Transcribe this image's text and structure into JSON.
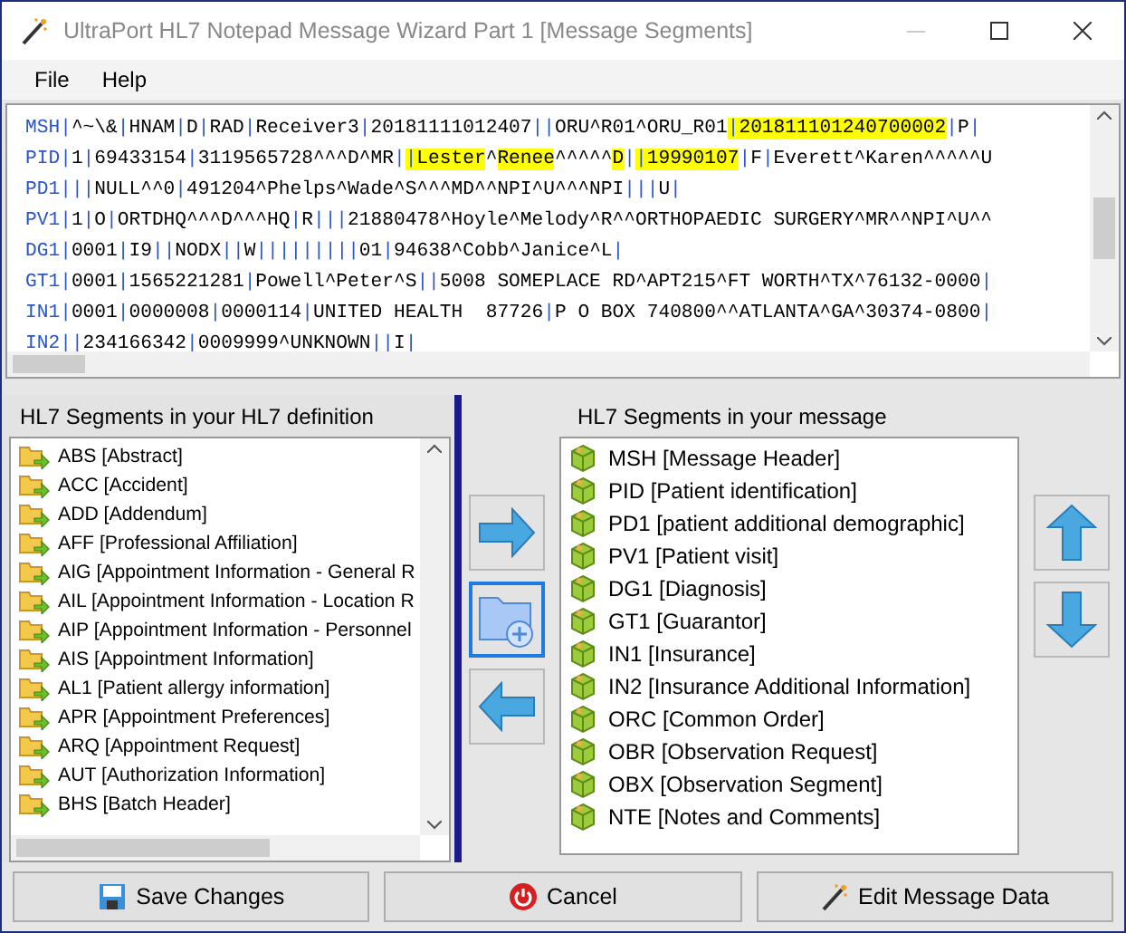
{
  "window": {
    "title": "UltraPort HL7 Notepad Message Wizard Part 1 [Message Segments]"
  },
  "menu": [
    "File",
    "Help"
  ],
  "message": {
    "lines": [
      {
        "segment": "MSH",
        "parts": [
          {
            "text": "|^~\\&|HNAM|D|RAD|Receiver3|20181111012407||ORU^R01^ORU_R01",
            "highlight": false
          },
          {
            "text": "|201811101240700002",
            "highlight": true
          },
          {
            "text": "|P|",
            "highlight": false
          }
        ]
      },
      {
        "segment": "PID",
        "parts": [
          {
            "text": "|1|69433154|3119565728^^^D^MR|",
            "highlight": false
          },
          {
            "text": "|Lester",
            "highlight": true
          },
          {
            "text": "^",
            "highlight": false
          },
          {
            "text": "Renee",
            "highlight": true
          },
          {
            "text": "^^^^^",
            "highlight": false
          },
          {
            "text": "D",
            "highlight": true
          },
          {
            "text": "|",
            "highlight": false
          },
          {
            "text": "|19990107",
            "highlight": true
          },
          {
            "text": "|F|Everett^Karen^^^^^U",
            "highlight": false
          }
        ]
      },
      {
        "segment": "PD1",
        "parts": [
          {
            "text": "|||NULL^^0|491204^Phelps^Wade^S^^^MD^^NPI^U^^^NPI|||U|",
            "highlight": false
          }
        ]
      },
      {
        "segment": "PV1",
        "parts": [
          {
            "text": "|1|O|ORTDHQ^^^D^^^HQ|R|||21880478^Hoyle^Melody^R^^ORTHOPAEDIC SURGERY^MR^^NPI^U^^",
            "highlight": false
          }
        ]
      },
      {
        "segment": "DG1",
        "parts": [
          {
            "text": "|0001|I9||NODX||W|||||||||01|94638^Cobb^Janice^L|",
            "highlight": false
          }
        ]
      },
      {
        "segment": "GT1",
        "parts": [
          {
            "text": "|0001|1565221281|Powell^Peter^S||5008 SOMEPLACE RD^APT215^FT WORTH^TX^76132-0000|",
            "highlight": false
          }
        ]
      },
      {
        "segment": "IN1",
        "parts": [
          {
            "text": "|0001|0000008|0000114|UNITED HEALTH  87726|P O BOX 740800^^ATLANTA^GA^30374-0800|",
            "highlight": false
          }
        ]
      },
      {
        "segment": "IN2",
        "parts": [
          {
            "text": "||234166342|0009999^UNKNOWN||I|",
            "highlight": false
          }
        ]
      }
    ]
  },
  "definition_panel": {
    "title": "HL7 Segments in your HL7 definition",
    "items": [
      "ABS [Abstract]",
      "ACC [Accident]",
      "ADD [Addendum]",
      "AFF [Professional Affiliation]",
      "AIG [Appointment Information - General R",
      "AIL [Appointment Information - Location R",
      "AIP [Appointment Information - Personnel",
      "AIS [Appointment Information]",
      "AL1 [Patient allergy information]",
      "APR [Appointment Preferences]",
      "ARQ [Appointment Request]",
      "AUT [Authorization Information]",
      "BHS [Batch Header]"
    ]
  },
  "message_panel": {
    "title": "HL7 Segments in your message",
    "items": [
      "MSH [Message Header]",
      "PID [Patient identification]",
      "PD1 [patient additional demographic]",
      "PV1 [Patient visit]",
      "DG1 [Diagnosis]",
      "GT1 [Guarantor]",
      "IN1 [Insurance]",
      "IN2 [Insurance Additional Information]",
      "ORC [Common Order]",
      "OBR [Observation Request]",
      "OBX [Observation Segment]",
      "NTE [Notes and Comments]"
    ]
  },
  "transfer_buttons": [
    {
      "kind": "add",
      "selected": false
    },
    {
      "kind": "new",
      "selected": true
    },
    {
      "kind": "remove",
      "selected": false
    }
  ],
  "buttons": [
    {
      "kind": "save",
      "label": "Save Changes"
    },
    {
      "kind": "cancel",
      "label": "Cancel"
    },
    {
      "kind": "edit",
      "label": "Edit Message Data"
    }
  ]
}
